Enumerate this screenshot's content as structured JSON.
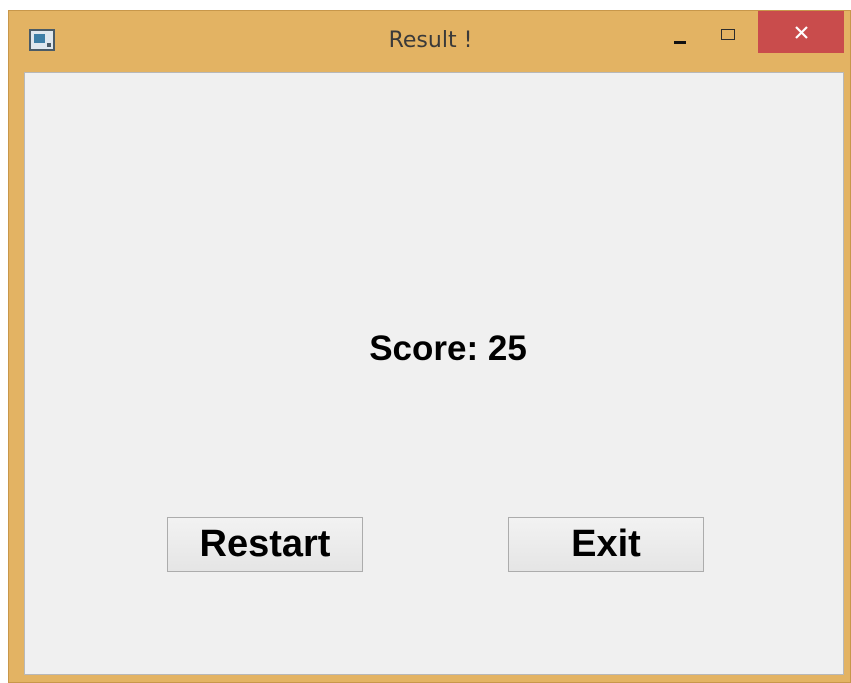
{
  "window": {
    "title": "Result !",
    "frame_color": "#e3b363",
    "close_color": "#c94c4c"
  },
  "content": {
    "score_text": "Score: 25"
  },
  "buttons": {
    "restart_label": "Restart",
    "exit_label": "Exit"
  },
  "icons": {
    "app": "app-window-icon",
    "minimize": "minimize-icon",
    "maximize": "maximize-icon",
    "close": "close-icon"
  }
}
